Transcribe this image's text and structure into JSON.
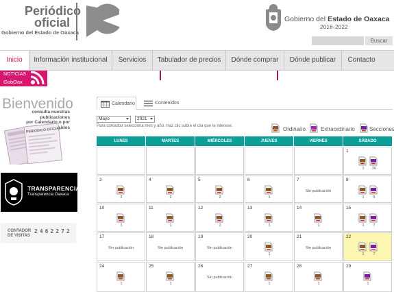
{
  "header": {
    "logo_title_line1": "Periódico",
    "logo_title_line2": "oficial",
    "logo_subtitle": "Gobierno del Estado de Oaxaca",
    "gov_name_prefix": "Gobierno ",
    "gov_name_mid": "del ",
    "gov_name_strong": "Estado de Oaxaca",
    "gov_years": "2016-2022",
    "search_placeholder": "",
    "search_button": "Buscar"
  },
  "nav": {
    "items": [
      "Inicio",
      "Información institucional",
      "Servicios",
      "Tabulador de precios",
      "Dónde comprar",
      "Dónde publicar",
      "Contacto"
    ],
    "active": "Inicio"
  },
  "news_badge": {
    "line1": "NOTICIAS",
    "line2": "GobOax"
  },
  "sidebar": {
    "welcome_title": "Bienvenido",
    "welcome_sub_line1": "consulta nuestras publicaciones",
    "welcome_sub_line2": "por Calendario o por Contenidos",
    "paper_mast": "PERIODICO OFICIAL",
    "transparency_title": "TRANSPARENCIA",
    "transparency_sub": "Transparencia Oaxaca",
    "counter_label_line1": "CONTADOR",
    "counter_label_line2": "DE VISITAS",
    "counter_value": "2462272"
  },
  "calendar": {
    "tabs": [
      "Calendario",
      "Contenidos"
    ],
    "active_tab": "Calendario",
    "month": "Mayo",
    "year": "2021",
    "help_text": "Para consultar selecciona mes y año. Haz clic sobre el día que te interese.",
    "legend": [
      "Ordinario",
      "Extraordinario",
      "Secciones"
    ],
    "colors": {
      "header": "#0d9e99",
      "highlight": "#fbf7b2",
      "ordinario": "#8b5a2b",
      "extraordinario": "#9c27b0",
      "secciones": "#7b1fa2",
      "accent": "#d6166f"
    },
    "weekdays": [
      "LUNES",
      "MARTES",
      "MIÉRCOLES",
      "JUEVES",
      "VIERNES",
      "SÁBADO"
    ],
    "no_pub_text": "Sin publicación",
    "weeks": [
      [
        null,
        null,
        null,
        null,
        null,
        {
          "day": "1",
          "pubs": [
            {
              "type": "ordinario",
              "count": "1"
            },
            {
              "type": "secciones",
              "count": "26"
            }
          ]
        }
      ],
      [
        {
          "day": "3",
          "pubs": [
            {
              "type": "ordinario",
              "count": "2"
            }
          ]
        },
        {
          "day": "4",
          "pubs": [
            {
              "type": "ordinario",
              "count": "2"
            }
          ]
        },
        {
          "day": "5",
          "pubs": [
            {
              "type": "ordinario",
              "count": "2"
            }
          ]
        },
        {
          "day": "6",
          "pubs": [
            {
              "type": "ordinario",
              "count": "1"
            }
          ]
        },
        {
          "day": "7",
          "none": true
        },
        {
          "day": "8",
          "pubs": [
            {
              "type": "ordinario",
              "count": "1"
            },
            {
              "type": "secciones",
              "count": "5"
            }
          ]
        }
      ],
      [
        {
          "day": "10",
          "pubs": [
            {
              "type": "ordinario",
              "count": "1"
            }
          ]
        },
        {
          "day": "11",
          "pubs": [
            {
              "type": "ordinario",
              "count": "1"
            }
          ]
        },
        {
          "day": "12",
          "pubs": [
            {
              "type": "ordinario",
              "count": "1"
            }
          ]
        },
        {
          "day": "13",
          "pubs": [
            {
              "type": "ordinario",
              "count": "1"
            }
          ]
        },
        {
          "day": "14",
          "pubs": [
            {
              "type": "ordinario",
              "count": "1"
            }
          ]
        },
        {
          "day": "15",
          "pubs": [
            {
              "type": "ordinario",
              "count": "1"
            },
            {
              "type": "secciones",
              "count": "7"
            }
          ]
        }
      ],
      [
        {
          "day": "17",
          "none": true
        },
        {
          "day": "18",
          "none": true
        },
        {
          "day": "19",
          "none": true
        },
        {
          "day": "20",
          "pubs": [
            {
              "type": "ordinario",
              "count": "1"
            }
          ]
        },
        {
          "day": "21",
          "none": true
        },
        {
          "day": "22",
          "highlight": true,
          "pubs": [
            {
              "type": "ordinario",
              "count": "1"
            },
            {
              "type": "secciones",
              "count": "7"
            }
          ]
        }
      ],
      [
        {
          "day": "24",
          "pubs": [
            {
              "type": "ordinario",
              "count": "1"
            }
          ]
        },
        {
          "day": "25",
          "pubs": [
            {
              "type": "ordinario",
              "count": "1"
            }
          ]
        },
        {
          "day": "26",
          "none": true
        },
        {
          "day": "27",
          "pubs": [
            {
              "type": "ordinario",
              "count": "1"
            }
          ]
        },
        {
          "day": "28",
          "pubs": [
            {
              "type": "ordinario",
              "count": "1"
            }
          ]
        },
        {
          "day": "29",
          "pubs": [
            {
              "type": "secciones",
              "count": "1"
            }
          ]
        }
      ]
    ]
  }
}
